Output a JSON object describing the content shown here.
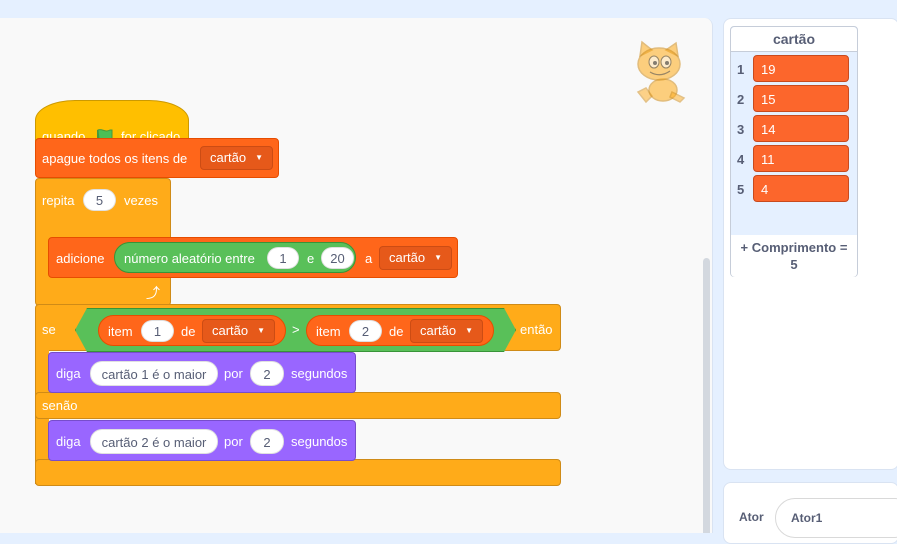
{
  "workspace": {
    "hat": {
      "before_flag": "quando",
      "after_flag": "for clicado"
    },
    "delete_all": {
      "label": "apague todos os itens de",
      "list": "cartão"
    },
    "repeat": {
      "label": "repita",
      "times": "5",
      "after": "vezes"
    },
    "add": {
      "label": "adicione",
      "random": {
        "label": "número aleatório entre",
        "from": "1",
        "connector": "e",
        "to": "20"
      },
      "to_word": "a",
      "list": "cartão"
    },
    "if_else": {
      "if_word": "se",
      "left": {
        "label": "item",
        "index": "1",
        "of": "de",
        "list": "cartão"
      },
      "operator": ">",
      "right": {
        "label": "item",
        "index": "2",
        "of": "de",
        "list": "cartão"
      },
      "then_word": "então",
      "else_word": "senão"
    },
    "say1": {
      "label": "diga",
      "message": "cartão 1 é o maior",
      "for": "por",
      "secs": "2",
      "unit": "segundos"
    },
    "say2": {
      "label": "diga",
      "message": "cartão 2 é o maior",
      "for": "por",
      "secs": "2",
      "unit": "segundos"
    }
  },
  "list_monitor": {
    "title": "cartão",
    "items": [
      {
        "index": "1",
        "value": "19"
      },
      {
        "index": "2",
        "value": "15"
      },
      {
        "index": "3",
        "value": "14"
      },
      {
        "index": "4",
        "value": "11"
      },
      {
        "index": "5",
        "value": "4"
      }
    ],
    "add_label": "+",
    "length_label": "Comprimento =",
    "length_value": "5"
  },
  "sprite_info": {
    "label": "Ator",
    "name": "Ator1"
  },
  "colors": {
    "events": "#ffbf00",
    "control": "#ffab19",
    "lists": "#ff661a",
    "looks": "#9966ff",
    "operators": "#59c059",
    "flag": "#4cbf56"
  },
  "icons": {
    "flag": "green-flag-icon",
    "loop": "loop-arrow-icon",
    "dropdown": "dropdown-arrow-icon",
    "sprite": "scratch-cat-icon"
  }
}
